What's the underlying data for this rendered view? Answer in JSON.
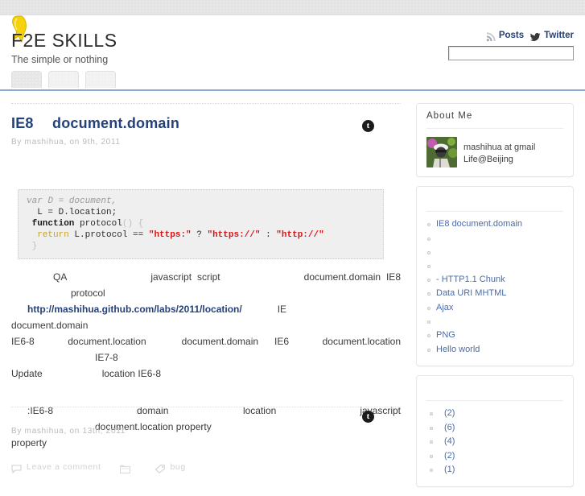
{
  "topbar": {
    "name": "top-decorative-band"
  },
  "header": {
    "logo_icon": "ribbon-icon",
    "site_title": "F2E SKILLS",
    "tagline": "The simple or nothing",
    "links": {
      "rss_icon": "rss-icon",
      "posts_label": "Posts",
      "bird_icon": "twitter-bird-icon",
      "twitter_label": "Twitter"
    },
    "search": {
      "value": "",
      "placeholder": ""
    }
  },
  "nav": {
    "tabs": [
      {
        "label": "",
        "active": true
      },
      {
        "label": "",
        "active": false
      },
      {
        "label": "",
        "active": false
      }
    ]
  },
  "posts": [
    {
      "title": "IE8  document.domain",
      "byline": "By mashihua, on   9th, 2011",
      "share_icon": "twitter-circle-icon",
      "code": {
        "lines": [
          [
            {
              "t": "var D = document,",
              "c": "c-com"
            }
          ],
          [
            {
              "t": "  L = D.location;",
              "c": "c-plain"
            }
          ],
          [
            {
              "t": " function",
              "c": "c-kw"
            },
            {
              "t": " protocol",
              "c": "c-plain"
            },
            {
              "t": "()",
              "c": "c-punct"
            },
            {
              "t": " {",
              "c": "c-punct"
            }
          ],
          [
            {
              "t": "  return",
              "c": "c-ret"
            },
            {
              "t": " L.protocol == ",
              "c": "c-plain"
            },
            {
              "t": "\"https:\"",
              "c": "c-str"
            },
            {
              "t": " ? ",
              "c": "c-plain"
            },
            {
              "t": "\"https://\"",
              "c": "c-str"
            },
            {
              "t": " : ",
              "c": "c-plain"
            },
            {
              "t": "\"http://\"",
              "c": "c-str"
            }
          ],
          [
            {
              "t": " }",
              "c": "c-punct"
            }
          ]
        ]
      },
      "paragraph1": {
        "seg1": "QA",
        "seg2": "javascript script",
        "seg3": "document.domain IE8",
        "seg4": "protocol",
        "link_text": "http://mashihua.github.com/labs/2011/location/",
        "seg5": "IE",
        "seg6": "document.domain",
        "seg7": "IE6-8 document.location",
        "seg8": "document.domain",
        "seg9": "IE6 document.location",
        "seg10": "IE7-8",
        "seg11": "Update",
        "seg12": "location IE6-8"
      },
      "paragraph2": {
        "seg1": ":IE6-8",
        "seg2": "domain location",
        "seg3": "javascript",
        "seg4": "document.location property",
        "seg5": "property"
      },
      "meta": {
        "comment_icon": "speech-bubble-icon",
        "comment_label": "Leave a comment",
        "category_icon": "folder-icon",
        "category_label": "",
        "tag_icon": "tag-icon",
        "tag_label": "bug"
      }
    },
    {
      "title": "",
      "byline": "By mashihua, on   13th, 2011",
      "share_icon": "twitter-circle-icon"
    }
  ],
  "sidebar": {
    "about": {
      "title": "About Me",
      "avatar": "author-avatar",
      "line1": "mashihua at gmail",
      "line2": "Life@Beijing"
    },
    "recent": {
      "title": "",
      "items": [
        "IE8  document.domain",
        "",
        "",
        "",
        " -  HTTP1.1  Chunk",
        "Data URI MHTML",
        " Ajax",
        "",
        "  PNG",
        "Hello world"
      ]
    },
    "archives": {
      "title": "",
      "items": [
        "(2)",
        "(6)",
        "(4)",
        "(2)",
        " (1)"
      ]
    }
  },
  "colors": {
    "accent_blue": "#24417a",
    "link_blue": "#4c6ba8",
    "rule_blue": "#8ca9d6",
    "ribbon_yellow": "#f5d20a",
    "code_bg": "#efefef",
    "string_red": "#dd1111"
  }
}
